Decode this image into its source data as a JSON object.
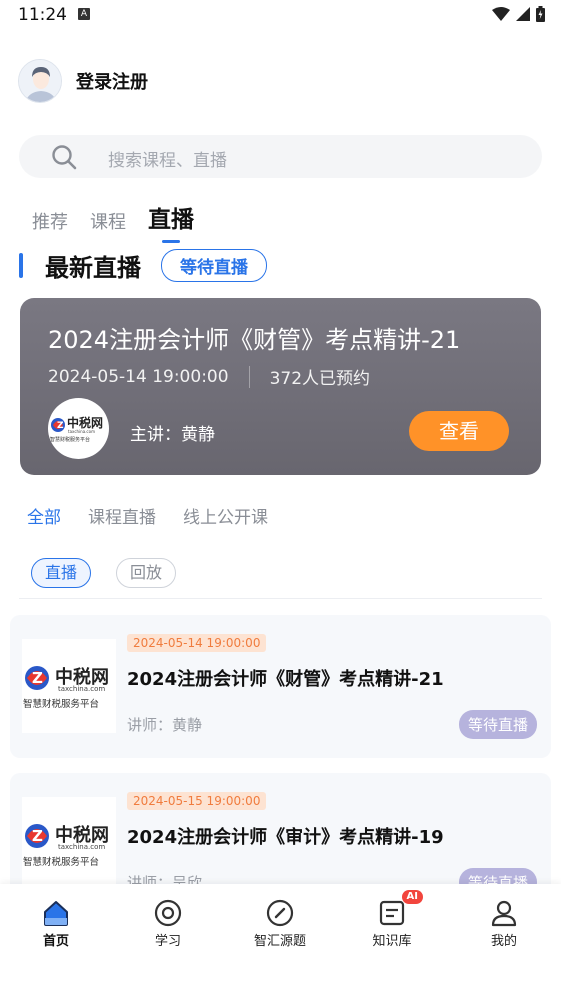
{
  "status_bar": {
    "time": "11:24",
    "a_icon": "A"
  },
  "login": {
    "label": "登录注册"
  },
  "search": {
    "placeholder": "搜索课程、直播"
  },
  "main_tabs": [
    {
      "label": "推荐"
    },
    {
      "label": "课程"
    },
    {
      "label": "直播"
    }
  ],
  "section": {
    "title": "最新直播",
    "badge": "等待直播"
  },
  "feature": {
    "title": "2024注册会计师《财管》考点精讲-21",
    "datetime": "2024-05-14 19:00:00",
    "reservations": "372人已预约",
    "lecturer": "主讲：黄静",
    "button": "查看",
    "logo_text": "中税网",
    "logo_sub": "taxchina.com",
    "logo_slogan": "智慧财税服务平台"
  },
  "sub_tabs": [
    {
      "label": "全部"
    },
    {
      "label": "课程直播"
    },
    {
      "label": "线上公开课"
    }
  ],
  "pills": [
    {
      "label": "直播"
    },
    {
      "label": "回放"
    }
  ],
  "list": [
    {
      "date": "2024-05-14 19:00:00",
      "title": "2024注册会计师《财管》考点精讲-21",
      "teacher": "讲师：黄静",
      "status": "等待直播",
      "logo_text": "中税网",
      "logo_sub": "taxchina.com",
      "logo_slogan": "智慧财税服务平台"
    },
    {
      "date": "2024-05-15 19:00:00",
      "title": "2024注册会计师《审计》考点精讲-19",
      "teacher": "讲师：吴欣",
      "status": "等待直播",
      "logo_text": "中税网",
      "logo_sub": "taxchina.com",
      "logo_slogan": "智慧财税服务平台"
    }
  ],
  "bottom_nav": [
    {
      "label": "首页",
      "icon": "home-icon"
    },
    {
      "label": "学习",
      "icon": "study-icon"
    },
    {
      "label": "智汇源题",
      "icon": "compass-icon"
    },
    {
      "label": "知识库",
      "icon": "knowledge-icon",
      "badge": "AI"
    },
    {
      "label": "我的",
      "icon": "user-icon"
    }
  ],
  "colors": {
    "accent": "#2a74e8",
    "orange": "#ff9228",
    "status_purple": "#b6b3dd",
    "ai_red": "#f2453d"
  }
}
